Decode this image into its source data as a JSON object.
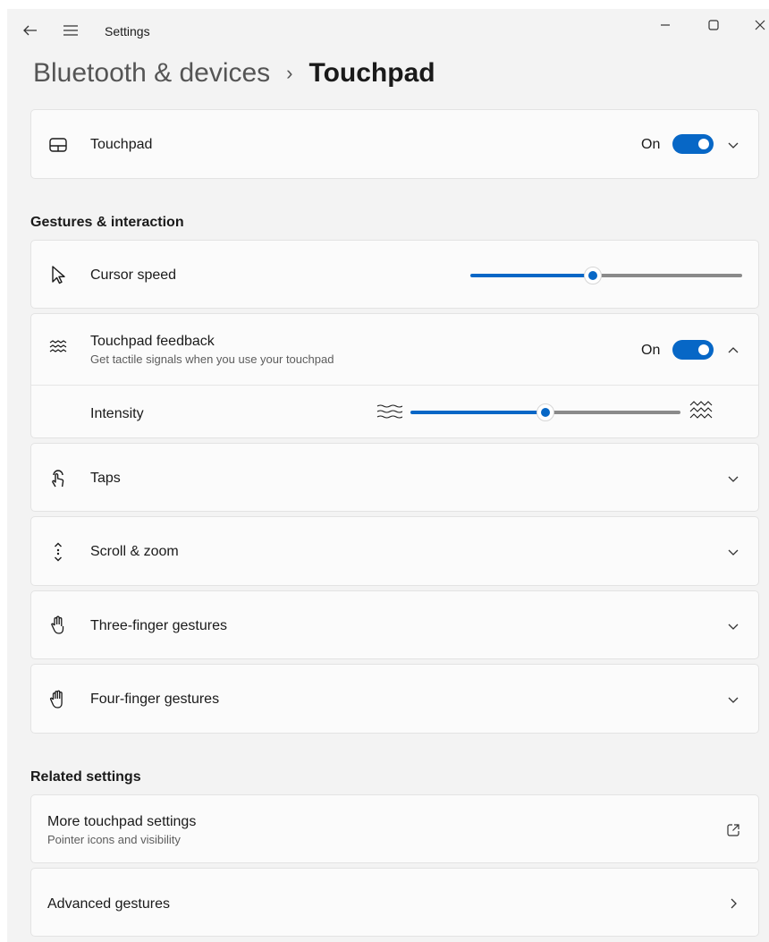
{
  "titlebar": {
    "title": "Settings"
  },
  "breadcrumb": {
    "parent": "Bluetooth & devices",
    "separator": "›",
    "current": "Touchpad"
  },
  "touchpad": {
    "label": "Touchpad",
    "state": "On",
    "enabled": true
  },
  "gestures_section": {
    "title": "Gestures & interaction"
  },
  "cursor_speed": {
    "label": "Cursor speed",
    "value_fraction": 0.45
  },
  "feedback": {
    "label": "Touchpad feedback",
    "description": "Get tactile signals when you use your touchpad",
    "state": "On",
    "enabled": true,
    "intensity": {
      "label": "Intensity",
      "value_fraction": 0.5
    }
  },
  "expanders": [
    {
      "label": "Taps",
      "icon": "tap-icon"
    },
    {
      "label": "Scroll & zoom",
      "icon": "scroll-icon"
    },
    {
      "label": "Three-finger gestures",
      "icon": "three-finger-icon"
    },
    {
      "label": "Four-finger gestures",
      "icon": "four-finger-icon"
    }
  ],
  "related_section": {
    "title": "Related settings"
  },
  "related": {
    "more": {
      "label": "More touchpad settings",
      "description": "Pointer icons and visibility"
    },
    "advanced": {
      "label": "Advanced gestures"
    }
  },
  "colors": {
    "accent": "#0767c6",
    "background": "#f3f3f3",
    "card": "#fbfbfb"
  }
}
